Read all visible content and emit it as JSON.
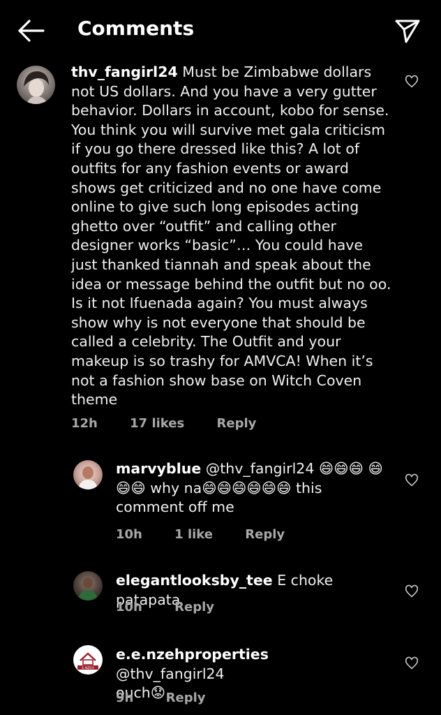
{
  "header": {
    "title": "Comments",
    "back_icon": "arrow-left-icon",
    "send_icon": "paper-plane-icon"
  },
  "comments": [
    {
      "username": "thv_fangirl24",
      "text": "Must be Zimbabwe dollars not US dollars. And you have a very gutter behavior. Dollars in account, kobo for sense. You think you will survive met gala criticism if you go there dressed like this? A lot of outfits for any fashion events or award shows get criticized and no one have come online to give such long episodes acting ghetto over “outfit” and calling other designer works “basic”… You could have just thanked tiannah and speak about the idea or message behind the outfit but no oo. Is it not Ifuenada again? You must always show why is not everyone that should be called a celebrity. The Outfit and your makeup is so trashy for AMVCA! When it’s not a fashion show base on Witch Coven theme",
      "time": "12h",
      "likes": "17 likes",
      "reply": "Reply"
    },
    {
      "username": "marvyblue",
      "mention": "@thv_fangirl24",
      "text": "😄😄😄 😄😄😄 why na😄😄😄😄😄😄 this comment off me",
      "time": "10h",
      "likes": "1 like",
      "reply": "Reply"
    },
    {
      "username": "elegantlooksby_tee",
      "text": "E choke patapata",
      "time": "10h",
      "reply": "Reply"
    },
    {
      "username": "e.e.nzehproperties",
      "mention": "@thv_fangirl24",
      "text": "ouch😟",
      "time": "9h",
      "reply": "Reply",
      "avatar_text": "E.NZEH"
    }
  ],
  "colors": {
    "background": "#000000",
    "text": "#f0f0f0",
    "meta": "#a8a8a8"
  }
}
